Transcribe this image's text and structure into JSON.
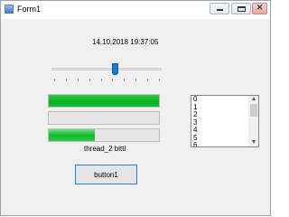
{
  "window": {
    "title": "Form1",
    "controls": {
      "minimize": "",
      "maximize": "",
      "close": "✕"
    }
  },
  "datetime_label": "14.10.2018 19:37:05",
  "trackbar": {
    "value_fraction": 0.58,
    "tick_count": 10
  },
  "progress_bars": [
    {
      "value_percent": 100
    },
    {
      "value_percent": 0
    },
    {
      "value_percent": 42
    }
  ],
  "status_label": "thread_2 bitti",
  "button1": {
    "label": "button1"
  },
  "listbox": {
    "items": [
      "0",
      "1",
      "2",
      "3",
      "4",
      "5",
      "6"
    ]
  },
  "colors": {
    "progress_green": "#06b025",
    "accent_blue": "#1977d2",
    "button_border": "#2a7dd4"
  }
}
